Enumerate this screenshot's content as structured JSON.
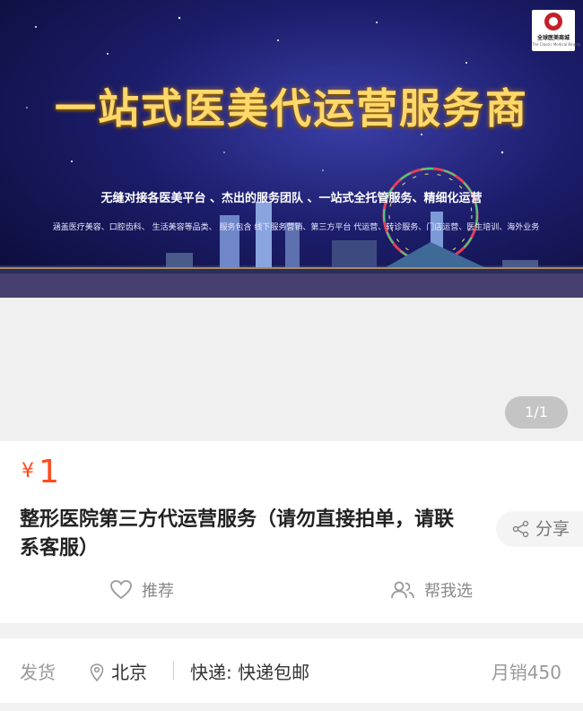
{
  "banner": {
    "headline": "一站式医美代运营服务商",
    "subtitle": "无缝对接各医美平台 、杰出的服务团队 、一站式全托管服务、精细化运营",
    "services": "涵盖医疗美容、口腔齿科、 生活美容等品类、 服务包含 线下服务营销、第三方平台 代运营、转诊服务、门店运营、医生培训、海外业务",
    "logo_text": "全球医美商城",
    "logo_subtext": "The Classic Medical Beauty",
    "colors": {
      "headline": "#ffd86b",
      "sky": "#1c1d6b"
    }
  },
  "gallery": {
    "pager": "1/1"
  },
  "product": {
    "currency": "¥",
    "price": "1",
    "title": "整形医院第三方代运营服务（请勿直接拍单，请联系客服）",
    "share_label": "分享",
    "recommend_label": "推荐",
    "help_choose_label": "帮我选",
    "price_color": "#ff4a1c"
  },
  "delivery": {
    "label": "发货",
    "location": "北京",
    "express": "快递: 快递包邮",
    "monthly_sales": "月销450"
  },
  "icons": [
    "location-pin-icon",
    "share-icon",
    "heart-icon",
    "users-icon"
  ]
}
